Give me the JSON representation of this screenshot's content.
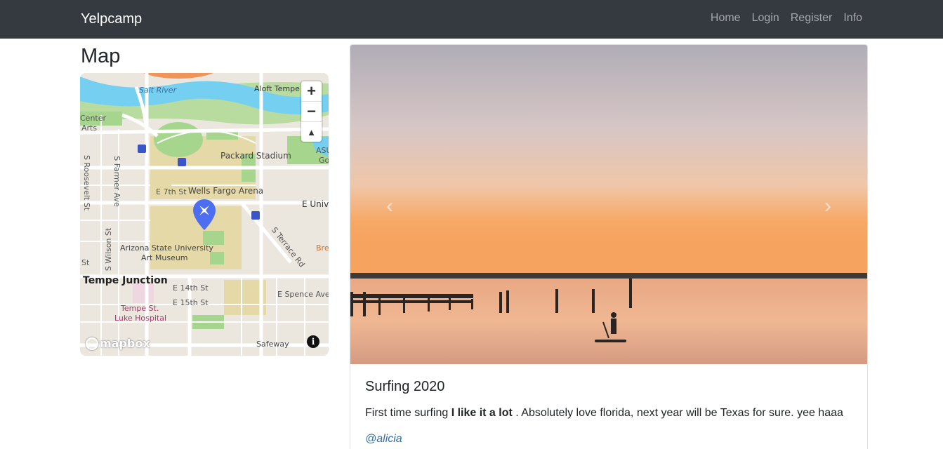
{
  "navbar": {
    "brand": "Yelpcamp",
    "links": [
      "Home",
      "Login",
      "Register",
      "Info"
    ]
  },
  "map_section": {
    "title": "Map",
    "labels": {
      "salt_river": "Salt River",
      "aloft": "Aloft Tempe",
      "center_arts_1": "Center",
      "center_arts_2": "Arts",
      "packard": "Packard Stadium",
      "asu_1": "ASU",
      "asu_2": "Go",
      "e7th": "E 7th St",
      "wells": "Wells Fargo Arena",
      "e_univ": "E Unive",
      "roosevelt": "S Roosevelt St",
      "farmer": "S Farmer Ave",
      "wilson": "S Wilson St",
      "st": "St",
      "terrace": "S Terrace Rd",
      "asu_museum_1": "Arizona State University",
      "asu_museum_2": "Art Museum",
      "bre": "Bre",
      "tempe_junction": "Tempe Junction",
      "e14th": "E 14th St",
      "e15th": "E 15th St",
      "spence": "E Spence Ave",
      "hosp_1": "Tempe St.",
      "hosp_2": "Luke Hospital",
      "safeway": "Safeway"
    },
    "zoom_in": "+",
    "zoom_out": "−",
    "compass": "▲",
    "logo": "mapbox",
    "info": "i"
  },
  "campground": {
    "title": "Surfing 2020",
    "text_before": "First time surfing ",
    "text_bold": "I like it a lot",
    "text_after": " . Absolutely love florida, next year will be Texas for sure. yee haaa",
    "author": "@alicia",
    "prev": "‹",
    "next": "›"
  }
}
